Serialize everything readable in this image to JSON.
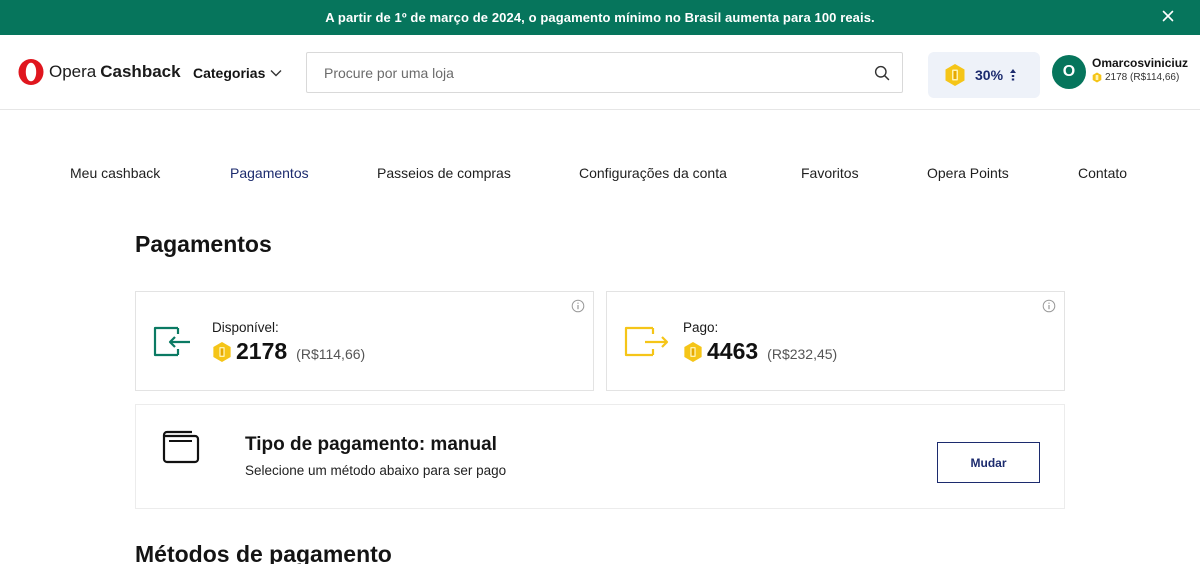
{
  "banner": {
    "text": "A partir de 1º de março de 2024, o pagamento mínimo no Brasil aumenta para 100 reais.",
    "close_icon": "close-icon"
  },
  "header": {
    "logo": {
      "word1": "Opera",
      "word2": "Cashback",
      "brand_color": "#e0161e"
    },
    "categories_label": "Categorias",
    "search": {
      "placeholder": "Procure por uma loja",
      "value": ""
    },
    "boost": {
      "percent": "30%",
      "icon": "coin-icon"
    },
    "user": {
      "avatar_initial": "O",
      "name": "Omarcosviniciuz",
      "points": "2178 (R$114,66)"
    }
  },
  "nav": {
    "items": [
      {
        "label": "Meu cashback",
        "active": false
      },
      {
        "label": "Pagamentos",
        "active": true
      },
      {
        "label": "Passeios de compras",
        "active": false
      },
      {
        "label": "Configurações da conta",
        "active": false
      },
      {
        "label": "Favoritos",
        "active": false
      },
      {
        "label": "Opera Points",
        "active": false
      },
      {
        "label": "Contato",
        "active": false
      }
    ]
  },
  "page": {
    "title": "Pagamentos",
    "available": {
      "label": "Disponível:",
      "value": "2178",
      "brl": "(R$114,66)"
    },
    "paid": {
      "label": "Pago:",
      "value": "4463",
      "brl": "(R$232,45)"
    },
    "payment_type": {
      "title": "Tipo de pagamento: manual",
      "subtitle": "Selecione um método abaixo para ser pago",
      "button_label": "Mudar"
    },
    "methods_title": "Métodos de pagamento"
  },
  "colors": {
    "banner_bg": "#06755c",
    "accent_navy": "#1c2b6e",
    "coin_yellow": "#f5c518",
    "wallet_green": "#0b7a63",
    "boost_bg": "#eef2f9"
  }
}
